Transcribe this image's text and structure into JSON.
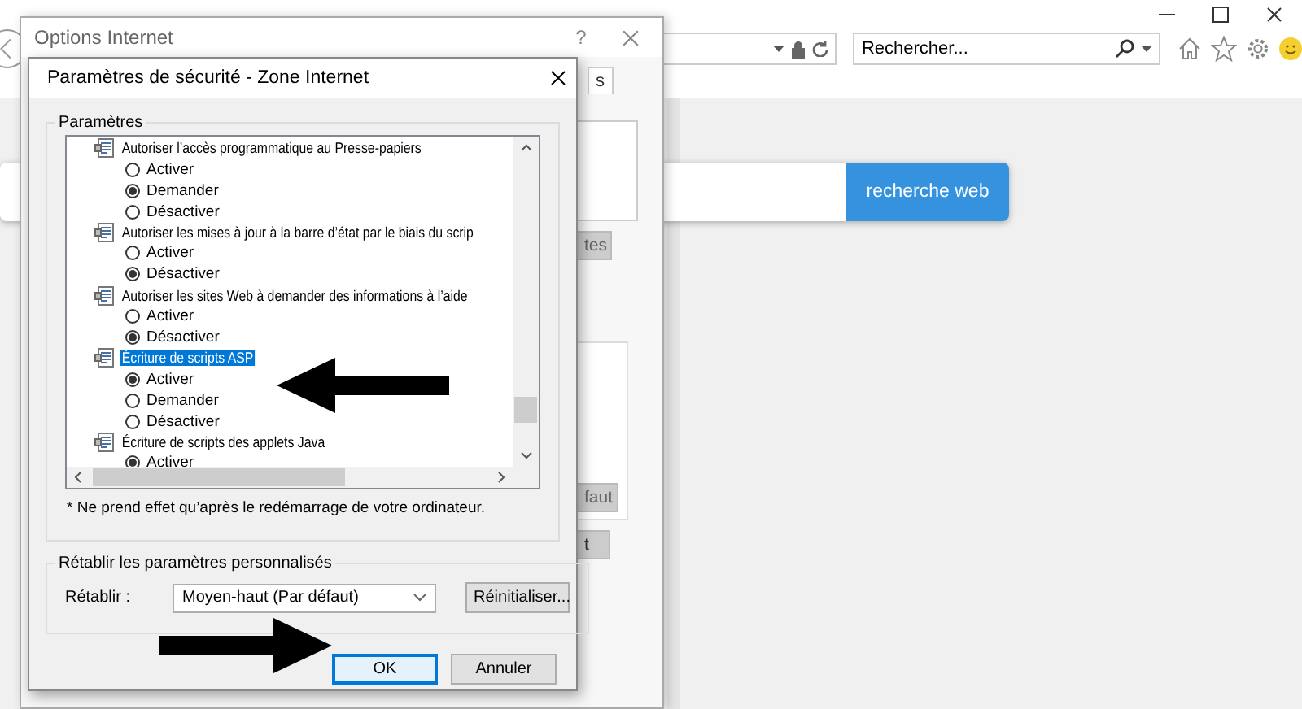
{
  "browser": {
    "search": {
      "placeholder": "Rechercher..."
    },
    "web_search": {
      "button": "recherche web"
    }
  },
  "options_dialog": {
    "title": "Options Internet",
    "help": "?",
    "partial_tab": "s",
    "partial_buttons": [
      "tes",
      "faut",
      "t"
    ]
  },
  "security_dialog": {
    "title": "Paramètres de sécurité - Zone Internet",
    "group_label": "Paramètres",
    "settings": [
      {
        "label": "Autoriser l’accès programmatique au Presse-papiers",
        "selected": false,
        "options": [
          {
            "label": "Activer",
            "selected": false
          },
          {
            "label": "Demander",
            "selected": true
          },
          {
            "label": "Désactiver",
            "selected": false
          }
        ]
      },
      {
        "label": "Autoriser les mises à jour à la barre d’état par le biais du scrip",
        "selected": false,
        "options": [
          {
            "label": "Activer",
            "selected": false
          },
          {
            "label": "Désactiver",
            "selected": true
          }
        ]
      },
      {
        "label": "Autoriser les sites Web à demander des informations à l’aide",
        "selected": false,
        "options": [
          {
            "label": "Activer",
            "selected": false
          },
          {
            "label": "Désactiver",
            "selected": true
          }
        ]
      },
      {
        "label": "Écriture de scripts ASP",
        "selected": true,
        "options": [
          {
            "label": "Activer",
            "selected": true
          },
          {
            "label": "Demander",
            "selected": false
          },
          {
            "label": "Désactiver",
            "selected": false
          }
        ]
      },
      {
        "label": "Écriture de scripts des applets Java",
        "selected": false,
        "options": [
          {
            "label": "Activer",
            "selected": true
          }
        ]
      }
    ],
    "note": "* Ne prend effet qu’après le redémarrage de votre ordinateur.",
    "reset": {
      "group_label": "Rétablir les paramètres personnalisés",
      "label": "Rétablir :",
      "value": "Moyen-haut (Par défaut)",
      "button": "Réinitialiser..."
    },
    "buttons": [
      {
        "label": "OK",
        "default": true
      },
      {
        "label": "Annuler",
        "default": false
      }
    ]
  },
  "annotations": [
    {
      "kind": "arrow-left"
    },
    {
      "kind": "arrow-right"
    }
  ]
}
